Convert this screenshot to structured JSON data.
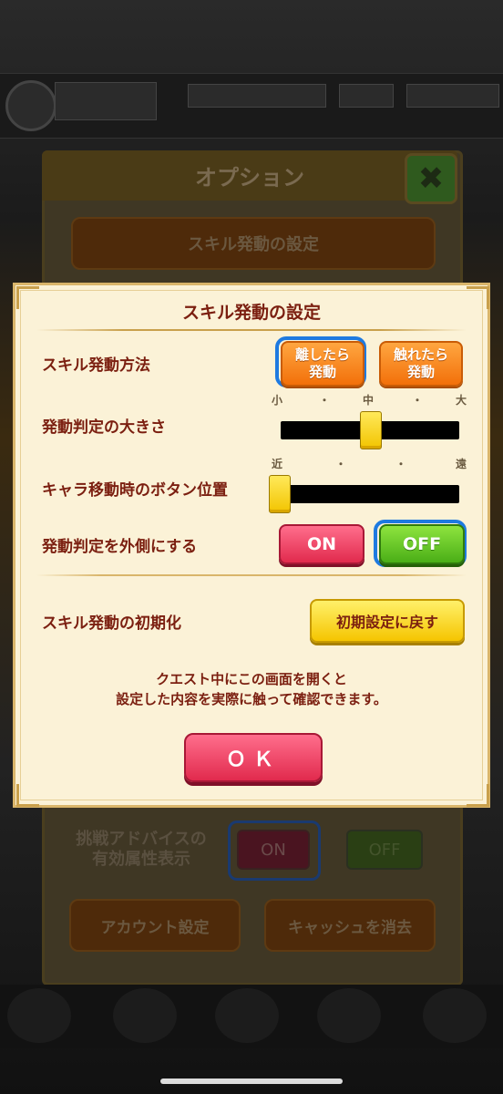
{
  "background": {
    "option_title": "オプション",
    "option_close_icon": "✖",
    "option_skill_button": "スキル発動の設定",
    "advice_label_line1": "挑戦アドバイスの",
    "advice_label_line2": "有効属性表示",
    "advice_on": "ON",
    "advice_off": "OFF",
    "account_button": "アカウント設定",
    "cache_button": "キャッシュを消去"
  },
  "modal": {
    "title": "スキル発動の設定",
    "method": {
      "label": "スキル発動方法",
      "options": [
        {
          "line1": "離したら",
          "line2": "発動",
          "selected": true
        },
        {
          "line1": "触れたら",
          "line2": "発動",
          "selected": false
        }
      ]
    },
    "size": {
      "label": "発動判定の大きさ",
      "ticks": [
        "小",
        "・",
        "中",
        "・",
        "大"
      ],
      "value": "中"
    },
    "position": {
      "label": "キャラ移動時のボタン位置",
      "ticks": [
        "近",
        "・",
        "・",
        "遠"
      ],
      "value": "近"
    },
    "outer": {
      "label": "発動判定を外側にする",
      "on": "ON",
      "off": "OFF",
      "selected": "OFF"
    },
    "reset": {
      "label": "スキル発動の初期化",
      "button": "初期設定に戻す"
    },
    "note_line1": "クエスト中にこの画面を開くと",
    "note_line2": "設定した内容を実際に触って確認できます。",
    "ok": "ＯＫ"
  },
  "colors": {
    "modal_bg": "#fbf2d7",
    "text_dark_red": "#7b1f10",
    "select_blue": "#1e7ae0",
    "on_red": "#e12a4d",
    "off_green": "#4aae17",
    "reset_yellow": "#f5c500",
    "method_orange": "#f2700a"
  }
}
